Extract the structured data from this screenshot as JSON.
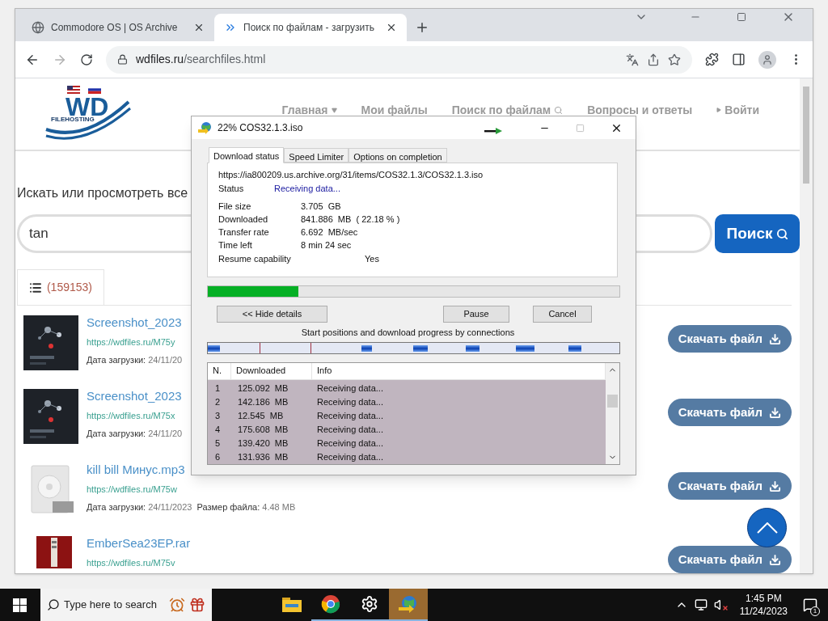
{
  "browser": {
    "tabs": [
      {
        "title": "Commodore OS | OS Archive",
        "kind": "globe",
        "selected": false
      },
      {
        "title": "Поиск по файлам - загрузить",
        "kind": "site",
        "selected": true
      }
    ],
    "url_host": "wdfiles.ru",
    "url_path": "/searchfiles.html"
  },
  "page": {
    "logo": {
      "letters": "WD",
      "tagline": "FILEHOSTING"
    },
    "nav": [
      {
        "label": "Главная",
        "kind": "dropdown"
      },
      {
        "label": "Мои файлы",
        "kind": "plain"
      },
      {
        "label": "Поиск по файлам",
        "kind": "search"
      },
      {
        "label": "Вопросы и ответы",
        "kind": "plain"
      },
      {
        "label": "Войти",
        "kind": "login"
      }
    ],
    "heading": "Искать или просмотреть все",
    "search": {
      "value": "tan",
      "button": "Поиск"
    },
    "results_tab": {
      "count": "(159153)",
      "selected": true
    },
    "results": [
      {
        "kind": "picture",
        "title": "Screenshot_2023",
        "link": "https://wdfiles.ru/M75y",
        "date_label": "Дата загрузки:",
        "date": "24/11/20",
        "button": "Скачать файл"
      },
      {
        "kind": "picture",
        "title": "Screenshot_2023",
        "link": "https://wdfiles.ru/M75x",
        "date_label": "Дата загрузки:",
        "date": "24/11/20",
        "button": "Скачать файл"
      },
      {
        "kind": "audio",
        "title": "kill bill Минус.mp3",
        "link": "https://wdfiles.ru/M75w",
        "date_label": "Дата загрузки:",
        "date": "24/11/2023",
        "size_label": "Размер файла:",
        "size": "4.48 MB",
        "button": "Скачать файл"
      },
      {
        "kind": "archive",
        "title": "EmberSea23EP.rar",
        "link": "https://wdfiles.ru/M75v",
        "button": "Скачать файл"
      }
    ]
  },
  "dialog": {
    "title": "22% COS32.1.3.iso",
    "tabs": [
      {
        "label": "Download status",
        "selected": true
      },
      {
        "label": "Speed Limiter",
        "selected": false
      },
      {
        "label": "Options on completion",
        "selected": false
      }
    ],
    "url": "https://ia800209.us.archive.org/31/items/COS32.1.3/COS32.1.3.iso",
    "status_label": "Status",
    "status_value": "Receiving data...",
    "fields": [
      {
        "label": "File size",
        "value": "3.705  GB"
      },
      {
        "label": "Downloaded",
        "value": "841.886  MB  ( 22.18 % )"
      },
      {
        "label": "Transfer rate",
        "value": "6.692  MB/sec"
      },
      {
        "label": "Time left",
        "value": "8 min 24 sec"
      }
    ],
    "resume_label": "Resume capability",
    "resume_value": "Yes",
    "level": 0.22,
    "buttons": {
      "details": "<< Hide details",
      "pause": "Pause",
      "cancel": "Cancel"
    },
    "connections_label": "Start positions and download progress by connections",
    "columns": [
      "N.",
      "Downloaded",
      "Info"
    ],
    "rows": [
      [
        "1",
        "125.092  MB",
        "Receiving data..."
      ],
      [
        "2",
        "142.186  MB",
        "Receiving data..."
      ],
      [
        "3",
        "12.545  MB",
        "Receiving data..."
      ],
      [
        "4",
        "175.608  MB",
        "Receiving data..."
      ],
      [
        "5",
        "139.420  MB",
        "Receiving data..."
      ],
      [
        "6",
        "131.936  MB",
        "Receiving data..."
      ]
    ]
  },
  "taskbar": {
    "search_placeholder": "Type here to search",
    "apps": [
      {
        "kind": "folder",
        "running": false,
        "selected": false
      },
      {
        "kind": "chrome",
        "running": true,
        "selected": false
      },
      {
        "kind": "settings",
        "running": true,
        "selected": false
      },
      {
        "kind": "downloader",
        "running": true,
        "selected": true
      }
    ],
    "time": "1:45 PM",
    "date": "11/24/2023",
    "notifications": "1"
  }
}
